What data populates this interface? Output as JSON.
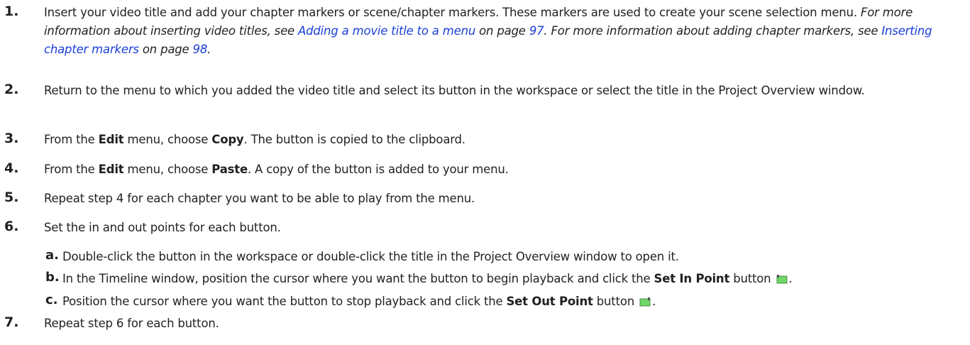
{
  "steps": [
    {
      "num": "1.",
      "text": "Insert your video title and add your chapter markers or scene/chapter markers. These markers are used to create your scene selection menu.",
      "info1_pre": "For more information about inserting video titles, see",
      "info1_link": "Adding a movie title to a menu",
      "info1_mid": "on page",
      "info1_page": "97",
      "info2_pre": ". For more information about adding chapter markers, see",
      "info2_link": "Inserting chapter markers",
      "info2_mid": "on page",
      "info2_page": "98",
      "end": "."
    },
    {
      "num": "2.",
      "text": "Return to the menu to which you added the video title and select its button in the workspace or select the title in the Project Overview window."
    },
    {
      "num": "3.",
      "pre": "From the",
      "b1": "Edit",
      "mid": "menu, choose",
      "b2": "Copy",
      "post": ". The button is copied to the clipboard."
    },
    {
      "num": "4.",
      "pre": "From the",
      "b1": "Edit",
      "mid": "menu, choose",
      "b2": "Paste",
      "post": ". A copy of the button is added to your menu."
    },
    {
      "num": "5.",
      "text": "Repeat step 4 for each chapter you want to be able to play from the menu."
    },
    {
      "num": "6.",
      "text": "Set the in and out points for each button.",
      "substeps": [
        {
          "letter": "a.",
          "text": "Double-click the button in the workspace or double-click the title in the Project Overview window to open it."
        },
        {
          "letter": "b.",
          "pre": "In the Timeline window, position the cursor where you want the button to begin playback and click the",
          "bold": "Set In Point",
          "post": "button",
          "icon": "set-in-point-icon",
          "end": "."
        },
        {
          "letter": "c.",
          "pre": "Position the cursor where you want the button to stop playback and click the",
          "bold": "Set Out Point",
          "post": "button",
          "icon": "set-out-point-icon",
          "end": "."
        }
      ]
    },
    {
      "num": "7.",
      "text": "Repeat step 6 for each button."
    }
  ],
  "colors": {
    "text": "#231f20",
    "link": "#1a3fd8",
    "icon_green": "#6fd66a"
  }
}
